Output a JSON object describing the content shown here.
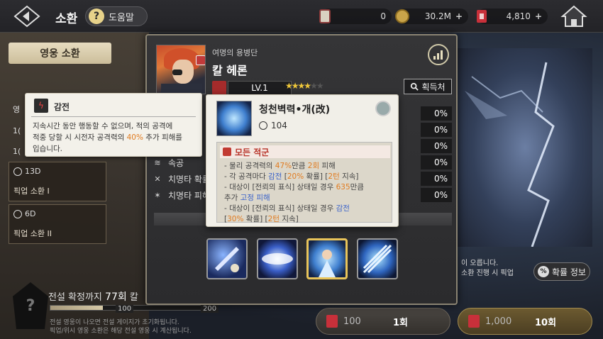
{
  "header": {
    "title": "소환",
    "help_label": "도움말",
    "currencies": [
      {
        "icon": "card-icon",
        "value": "0"
      },
      {
        "icon": "gold-coin-icon",
        "value": "30.2M"
      },
      {
        "icon": "ticket-icon",
        "value": "4,810"
      }
    ]
  },
  "left": {
    "tab_label": "영웅 소환",
    "fragments": [
      "영",
      "1(",
      "1("
    ],
    "cards": [
      {
        "timer": "13D",
        "label": "픽업 소환 I"
      },
      {
        "timer": "6D",
        "label": "픽업 소환 II"
      }
    ],
    "legend_text": "전설 확정까지",
    "legend_count": "77회",
    "legend_suffix": "칼 ",
    "progress": {
      "value": 0.33,
      "tick_mid": "100",
      "tick_end": "200"
    },
    "notes": [
      "전설 영웅이 나오면 전설 게이지가 초기화됩니다.",
      "픽업/위시 영웅 소환은 해당 전설 영웅 시 계산됩니다."
    ]
  },
  "modal": {
    "hero_group": "여명의 용병단",
    "hero_name": "칼 헤론",
    "level": "LV.1",
    "stars_on": 4,
    "stars_total": 6,
    "acquire_label": "획득처",
    "stats": [
      {
        "icon": "",
        "label": "",
        "value": "0%"
      },
      {
        "icon": "",
        "label": "",
        "value": "0%"
      },
      {
        "icon": "",
        "label": "",
        "value": "0%"
      },
      {
        "icon": "wind-icon",
        "label": "속공",
        "value": "0%"
      },
      {
        "icon": "crit-icon",
        "label": "치명타 확률",
        "value": "0%"
      },
      {
        "icon": "crit-dmg-icon",
        "label": "치명타 피해",
        "value": "0%"
      }
    ]
  },
  "shock_tooltip": {
    "title": "감전",
    "desc_1": "지속시간 동안 행동할 수 없으며, 적의 공격에",
    "desc_2a": "적중 당할 시 시전자 공격력의 ",
    "desc_2b": "40%",
    "desc_2c": " 추가 피해를",
    "desc_3": "입습니다."
  },
  "skill_tooltip": {
    "name": "청천벽력•개(改)",
    "cooldown": "104",
    "target": "모든 적군",
    "l1a": "- 물리 공격력의 ",
    "l1b": "47%",
    "l1c": "만큼 ",
    "l1d": "2회",
    "l1e": " 피해",
    "l2a": "- 각 공격마다 ",
    "l2b": "감전",
    "l2c": " [",
    "l2d": "20%",
    "l2e": " 확률] [",
    "l2f": "2턴",
    "l2g": " 지속]",
    "l3a": "- 대상이 [전뢰의 표식] 상태일 경우 ",
    "l3b": "635",
    "l3c": "만큼",
    "l4a": "추가 ",
    "l4b": "고정 피해",
    "l5a": "- 대상이 [전뢰의 표식] 상태일 경우 ",
    "l5b": "감전",
    "l6a": "[",
    "l6b": "30%",
    "l6c": " 확률] [",
    "l6d": "2턴",
    "l6e": " 지속]"
  },
  "right": {
    "info_1": "이 오릅니다.",
    "info_2": "소환 진행 시 픽업",
    "prob_label": "확률 정보"
  },
  "summon": {
    "single": {
      "cost": "100",
      "count": "1회"
    },
    "ten": {
      "cost": "1,000",
      "count": "10회"
    }
  }
}
